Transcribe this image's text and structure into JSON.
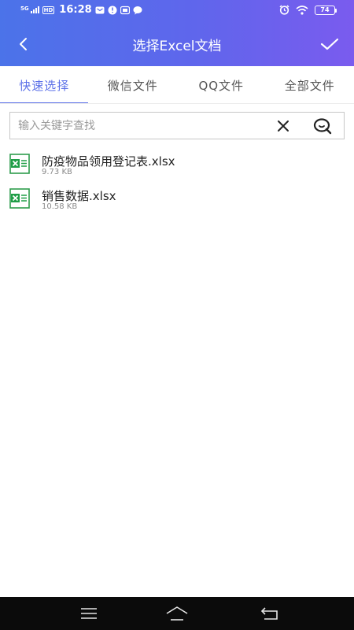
{
  "status_bar": {
    "network": "5G",
    "hd_badge": "HD",
    "time": "16:28",
    "battery": "74",
    "icons": [
      "signal-icon",
      "hd-icon",
      "mail-icon",
      "notification-icon",
      "message-icon",
      "chat-icon",
      "alarm-icon",
      "wifi-icon",
      "battery-icon"
    ]
  },
  "header": {
    "title": "选择Excel文档",
    "back_icon": "back-arrow-icon",
    "confirm_icon": "check-icon"
  },
  "tabs": [
    {
      "label": "快速选择",
      "active": true
    },
    {
      "label": "微信文件",
      "active": false
    },
    {
      "label": "QQ文件",
      "active": false
    },
    {
      "label": "全部文件",
      "active": false
    }
  ],
  "search": {
    "placeholder": "输入关键字查找",
    "value": "",
    "clear_icon": "close-icon",
    "search_icon": "search-icon"
  },
  "files": [
    {
      "name": "防疫物品领用登记表.xlsx",
      "size": "9.73 KB",
      "icon": "excel-file-icon"
    },
    {
      "name": "销售数据.xlsx",
      "size": "10.58 KB",
      "icon": "excel-file-icon"
    }
  ],
  "nav_bar": {
    "icons": [
      "menu-icon",
      "home-icon",
      "back-icon"
    ]
  },
  "colors": {
    "header_gradient_start": "#4b73e9",
    "header_gradient_end": "#7a5bee",
    "accent": "#5b70e8",
    "excel_green": "#1f9e47",
    "navbar": "#0b0b0b"
  }
}
